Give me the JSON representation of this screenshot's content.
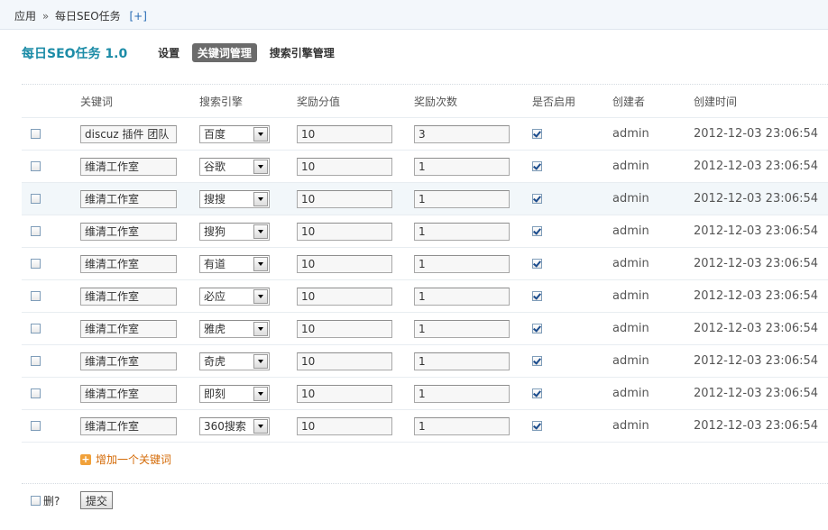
{
  "breadcrumb": {
    "home": "应用",
    "separator": "»",
    "current": "每日SEO任务",
    "add": "[+]"
  },
  "header": {
    "title": "每日SEO任务 1.0",
    "nav": [
      {
        "label": "设置",
        "active": false
      },
      {
        "label": "关键词管理",
        "active": true
      },
      {
        "label": "搜索引擎管理",
        "active": false
      }
    ]
  },
  "table": {
    "columns": [
      "关键词",
      "搜索引擎",
      "奖励分值",
      "奖励次数",
      "是否启用",
      "创建者",
      "创建时间"
    ],
    "rows": [
      {
        "keyword": "discuz 插件 团队",
        "engine": "百度",
        "points": "10",
        "count": "3",
        "enabled": true,
        "creator": "admin",
        "created": "2012-12-03 23:06:54"
      },
      {
        "keyword": "维清工作室",
        "engine": "谷歌",
        "points": "10",
        "count": "1",
        "enabled": true,
        "creator": "admin",
        "created": "2012-12-03 23:06:54"
      },
      {
        "keyword": "维清工作室",
        "engine": "搜搜",
        "points": "10",
        "count": "1",
        "enabled": true,
        "creator": "admin",
        "created": "2012-12-03 23:06:54"
      },
      {
        "keyword": "维清工作室",
        "engine": "搜狗",
        "points": "10",
        "count": "1",
        "enabled": true,
        "creator": "admin",
        "created": "2012-12-03 23:06:54"
      },
      {
        "keyword": "维清工作室",
        "engine": "有道",
        "points": "10",
        "count": "1",
        "enabled": true,
        "creator": "admin",
        "created": "2012-12-03 23:06:54"
      },
      {
        "keyword": "维清工作室",
        "engine": "必应",
        "points": "10",
        "count": "1",
        "enabled": true,
        "creator": "admin",
        "created": "2012-12-03 23:06:54"
      },
      {
        "keyword": "维清工作室",
        "engine": "雅虎",
        "points": "10",
        "count": "1",
        "enabled": true,
        "creator": "admin",
        "created": "2012-12-03 23:06:54"
      },
      {
        "keyword": "维清工作室",
        "engine": "奇虎",
        "points": "10",
        "count": "1",
        "enabled": true,
        "creator": "admin",
        "created": "2012-12-03 23:06:54"
      },
      {
        "keyword": "维清工作室",
        "engine": "即刻",
        "points": "10",
        "count": "1",
        "enabled": true,
        "creator": "admin",
        "created": "2012-12-03 23:06:54"
      },
      {
        "keyword": "维清工作室",
        "engine": "360搜索",
        "points": "10",
        "count": "1",
        "enabled": true,
        "creator": "admin",
        "created": "2012-12-03 23:06:54"
      }
    ],
    "highlighted_row": 2
  },
  "add_keyword_label": "增加一个关键词",
  "footer": {
    "delete_label": "删?",
    "submit_label": "提交"
  },
  "colors": {
    "title": "#1c8ca7",
    "active_tab_bg": "#6b6b6b",
    "add_link": "#d46b08",
    "row_highlight": "#f2f7fa"
  }
}
